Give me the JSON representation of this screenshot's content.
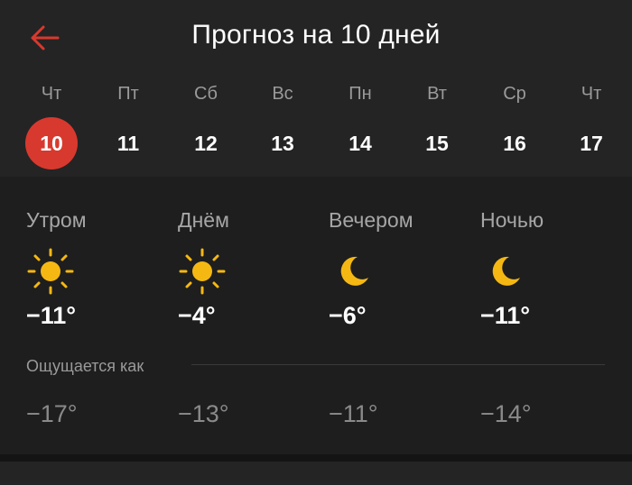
{
  "header": {
    "back_icon": "arrow-left-icon",
    "title": "Прогноз на 10 дней",
    "accent_color": "#d8392e"
  },
  "days": [
    {
      "name": "Чт",
      "num": "10",
      "selected": true
    },
    {
      "name": "Пт",
      "num": "11",
      "selected": false
    },
    {
      "name": "Сб",
      "num": "12",
      "selected": false
    },
    {
      "name": "Вс",
      "num": "13",
      "selected": false
    },
    {
      "name": "Пн",
      "num": "14",
      "selected": false
    },
    {
      "name": "Вт",
      "num": "15",
      "selected": false
    },
    {
      "name": "Ср",
      "num": "16",
      "selected": false
    },
    {
      "name": "Чт",
      "num": "17",
      "selected": false
    }
  ],
  "periods": [
    {
      "label": "Утром",
      "icon": "sun-icon",
      "temp": "−11°",
      "feels": "−17°"
    },
    {
      "label": "Днём",
      "icon": "sun-icon",
      "temp": "−4°",
      "feels": "−13°"
    },
    {
      "label": "Вечером",
      "icon": "moon-icon",
      "temp": "−6°",
      "feels": "−11°"
    },
    {
      "label": "Ночью",
      "icon": "moon-icon",
      "temp": "−11°",
      "feels": "−14°"
    }
  ],
  "feels_like_label": "Ощущается как"
}
